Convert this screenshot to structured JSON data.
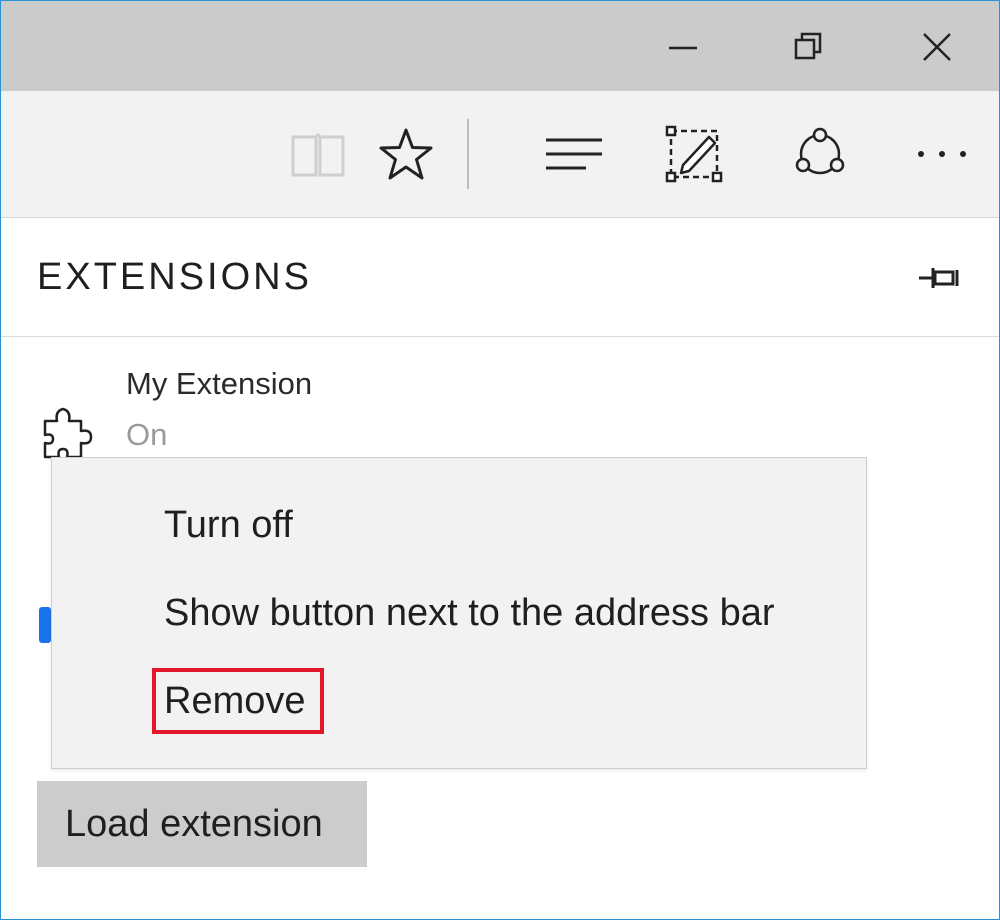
{
  "window": {
    "controls": {
      "minimize": "minimize-icon",
      "restore": "restore-icon",
      "close": "close-icon"
    }
  },
  "toolbar": {
    "icons": [
      "reading-view-icon",
      "favorite-star-icon",
      "hub-icon",
      "web-note-icon",
      "share-icon",
      "more-icon"
    ]
  },
  "panel": {
    "title": "EXTENSIONS",
    "pin_icon": "pin-icon"
  },
  "extension": {
    "name": "My Extension",
    "status": "On",
    "icon": "puzzle-piece-icon"
  },
  "context_menu": {
    "items": [
      {
        "label": "Turn off"
      },
      {
        "label": "Show button next to the address bar"
      },
      {
        "label": "Remove",
        "highlighted": true
      }
    ],
    "highlight_color": "#e2172a"
  },
  "load_button": {
    "label": "Load extension"
  },
  "colors": {
    "titlebar": "#cbcbcb",
    "toolbar": "#f2f2f2",
    "window_border": "#2b8fd8",
    "button_bg": "#cccccc"
  }
}
